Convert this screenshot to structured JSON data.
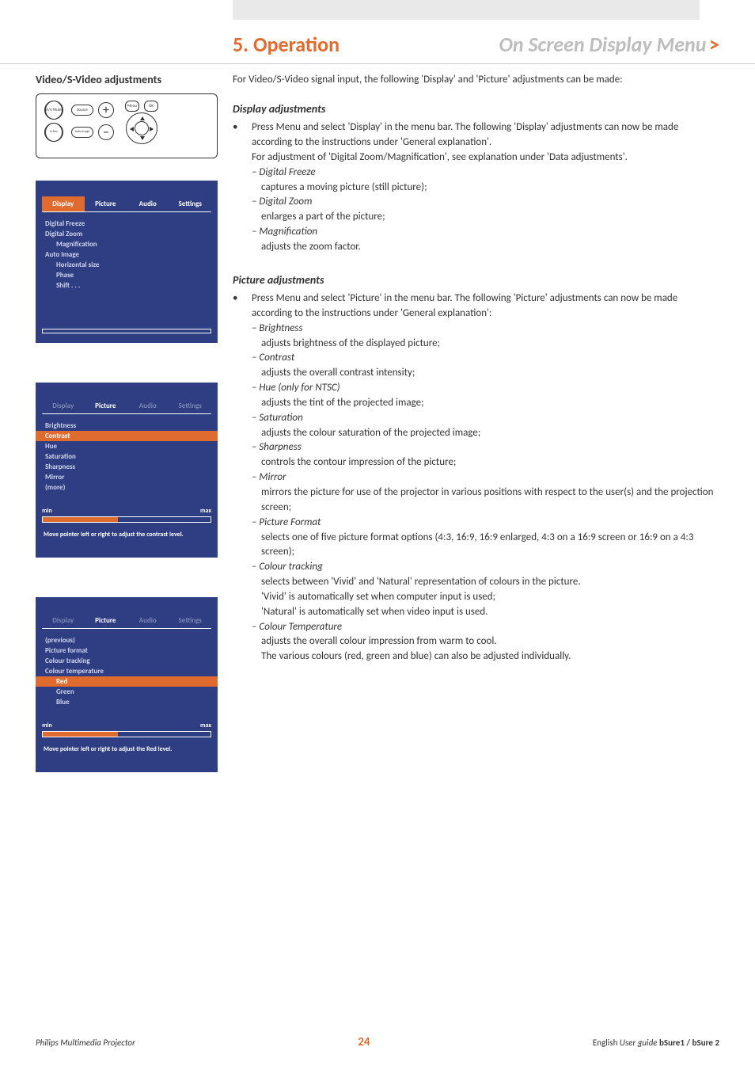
{
  "header": {
    "chapter": "5. Operation",
    "title": "On Screen Display Menu",
    "gt": ">"
  },
  "left": {
    "heading": "Video/S-Video adjustments",
    "remote": {
      "av_mute": "A/V Mute",
      "dkey": "D-key",
      "source": "Source",
      "auto_image": "Auto Image",
      "plus": "+",
      "minus": "−",
      "menu": "Menu",
      "ok": "OK"
    },
    "osd1": {
      "tabs": [
        "Display",
        "Picture",
        "Audio",
        "Settings"
      ],
      "active_index": 0,
      "items": [
        {
          "label": "Digital Freeze",
          "indent": 0
        },
        {
          "label": "Digital Zoom",
          "indent": 0
        },
        {
          "label": "Magnification",
          "indent": 1
        },
        {
          "label": "Auto Image",
          "indent": 0
        },
        {
          "label": "Horizontal size",
          "indent": 1
        },
        {
          "label": "Phase",
          "indent": 1
        },
        {
          "label": "Shift . . .",
          "indent": 1
        }
      ]
    },
    "osd2": {
      "tabs": [
        "Display",
        "Picture",
        "Audio",
        "Settings"
      ],
      "active_index": 1,
      "items": [
        {
          "label": "Brightness"
        },
        {
          "label": "Contrast",
          "selected": true
        },
        {
          "label": "Hue"
        },
        {
          "label": "Saturation"
        },
        {
          "label": "Sharpness"
        },
        {
          "label": "Mirror"
        },
        {
          "label": "(more)"
        }
      ],
      "bar": {
        "min": "min",
        "max": "max",
        "fill_pct": 45
      },
      "hint": "Move pointer left or right to adjust the contrast level."
    },
    "osd3": {
      "tabs": [
        "Display",
        "Picture",
        "Audio",
        "Settings"
      ],
      "active_index": 1,
      "items": [
        {
          "label": "(previous)"
        },
        {
          "label": "Picture format"
        },
        {
          "label": "Colour tracking"
        },
        {
          "label": "Colour temperature"
        },
        {
          "label": "Red",
          "indent": 1,
          "selected": true
        },
        {
          "label": "Green",
          "indent": 1
        },
        {
          "label": "Blue",
          "indent": 1
        }
      ],
      "bar": {
        "min": "min",
        "max": "max",
        "fill_pct": 45
      },
      "hint": "Move pointer left or right to adjust the Red level."
    }
  },
  "right": {
    "intro": "For Video/S-Video signal input, the following 'Display' and 'Picture' adjustments can be made:",
    "display": {
      "heading": "Display adjustments",
      "bullet": "Press Menu and select 'Display' in the menu bar.  The following 'Display' adjustments can now be made according to the instructions under 'General explanation'.",
      "note": "For adjustment of 'Digital Zoom/Magnification', see explanation under 'Data adjustments'.",
      "items": [
        {
          "label": "Digital Freeze",
          "desc": "captures a moving picture (still picture);"
        },
        {
          "label": "Digital Zoom",
          "desc": "enlarges a part of the picture;"
        },
        {
          "label": "Magnification",
          "desc": "adjusts the zoom factor."
        }
      ]
    },
    "picture": {
      "heading": "Picture adjustments",
      "bullet": "Press Menu and select 'Picture' in the menu bar.  The following 'Picture' adjustments can now be made according to the instructions under 'General explanation':",
      "items": [
        {
          "label": "Brightness",
          "desc": "adjusts brightness of the displayed picture;"
        },
        {
          "label": "Contrast",
          "desc": "adjusts the overall contrast intensity;"
        },
        {
          "label": "Hue (only for NTSC)",
          "desc": "adjusts the tint of the projected image;"
        },
        {
          "label": "Saturation",
          "desc": "adjusts the colour saturation of the projected image;"
        },
        {
          "label": "Sharpness",
          "desc": "controls the contour impression of the picture;"
        },
        {
          "label": "Mirror",
          "desc": "mirrors the picture for use of the projector in various positions with respect to the user(s) and the projection screen;"
        },
        {
          "label": "Picture Format",
          "desc": "selects one of five picture format options (4:3, 16:9, 16:9 enlarged, 4:3 on a 16:9 screen or 16:9 on a 4:3 screen);"
        },
        {
          "label": "Colour tracking",
          "desc": "selects between 'Vivid' and 'Natural' representation of colours in the picture.",
          "extra1": "'Vivid' is automatically set when computer input is used;",
          "extra2": "'Natural' is automatically set when video input is used."
        },
        {
          "label": "Colour Temperature",
          "desc": "adjusts the overall colour impression from warm to cool.",
          "extra1": "The various colours (red, green and blue) can also be adjusted individually."
        }
      ]
    }
  },
  "footer": {
    "left": "Philips Multimedia Projector",
    "page": "24",
    "right_lang": "English",
    "right_guide": "User guide",
    "right_model": "bSure1 / bSure 2"
  }
}
